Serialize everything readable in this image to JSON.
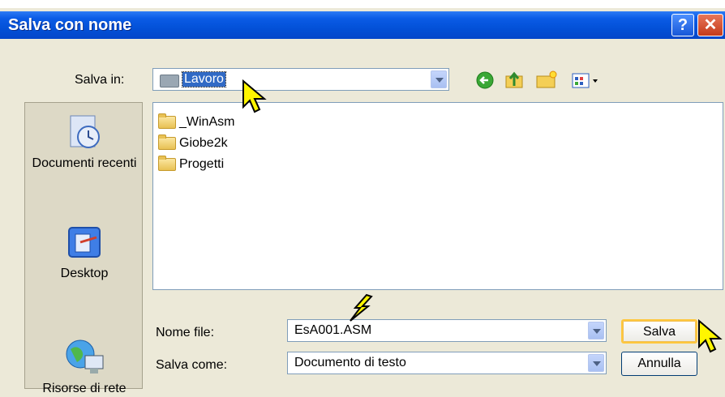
{
  "window": {
    "title": "Salva con nome"
  },
  "toolbar": {
    "save_in_label": "Salva in:",
    "save_in_value": "Lavoro"
  },
  "places": [
    {
      "label": "Documenti recenti",
      "icon": "recent-documents-icon"
    },
    {
      "label": "Desktop",
      "icon": "desktop-icon"
    },
    {
      "label": "Risorse di rete",
      "icon": "network-places-icon"
    }
  ],
  "files": [
    {
      "name": "_WinAsm"
    },
    {
      "name": "Giobe2k"
    },
    {
      "name": "Progetti"
    }
  ],
  "form": {
    "filename_label": "Nome file:",
    "filename_value": "EsA001.ASM",
    "filetype_label": "Salva come:",
    "filetype_value": "Documento di testo"
  },
  "buttons": {
    "save": "Salva",
    "cancel": "Annulla"
  },
  "colors": {
    "titlebar": "#0351d8",
    "dialog_bg": "#ece9d8",
    "default_button_border": "#ffc73c"
  }
}
